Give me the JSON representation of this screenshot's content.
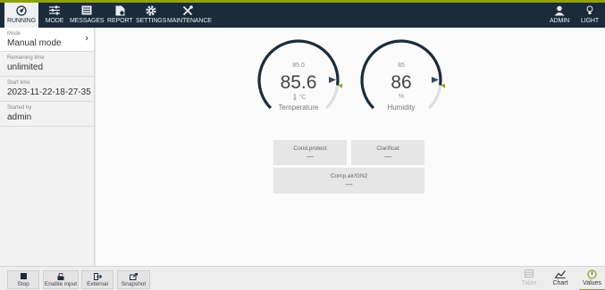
{
  "toolbar": {
    "running": "RUNNING",
    "mode": "MODE",
    "messages": "MESSAGES",
    "report": "REPORT",
    "settings": "SETTINGS",
    "maintenance": "MAINTENANCE",
    "admin": "ADMIN",
    "light": "LIGHT"
  },
  "sidebar": {
    "mode_label": "Mode",
    "mode_value": "Manual mode",
    "remaining_label": "Remaining time",
    "remaining_value": "unlimited",
    "start_label": "Start time",
    "start_value": "2023-11-22-18-27-35",
    "started_label": "Started by",
    "started_value": "admin"
  },
  "gauges": {
    "temperature": {
      "setpoint": "85.0",
      "value": "85.6",
      "unit": "°C",
      "name": "Temperature",
      "fraction": 0.86
    },
    "humidity": {
      "setpoint": "85",
      "value": "86",
      "unit": "%",
      "name": "Humidity",
      "fraction": 0.86
    }
  },
  "tiles": {
    "cond_protect": {
      "label": "Cond.protect",
      "value": "—"
    },
    "clarificat": {
      "label": "Clarificat",
      "value": "—"
    },
    "comp_air": {
      "label": "Comp.air/GN2",
      "value": "—"
    }
  },
  "bottom": {
    "stop": "Stop",
    "enable_input": "Enable input",
    "external": "External",
    "snapshot": "Snapshot",
    "table": "Table",
    "chart": "Chart",
    "values": "Values"
  },
  "colors": {
    "accent": "#8ea300",
    "topbar": "#1c2b3a",
    "gauge_arc": "#1c2b3a"
  }
}
